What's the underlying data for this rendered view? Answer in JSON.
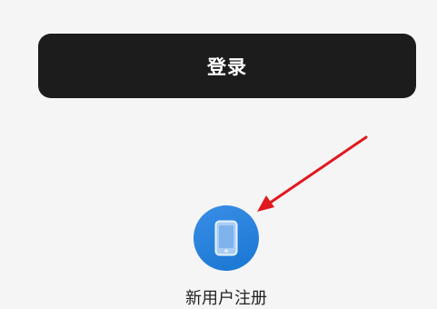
{
  "login": {
    "label": "登录"
  },
  "register": {
    "label": "新用户注册",
    "icon": "smartphone-icon"
  },
  "annotation": {
    "icon": "red-arrow-annotation"
  },
  "colors": {
    "background": "#f5f5f5",
    "login_button": "#1c1c1c",
    "register_icon": "#1976d2",
    "annotation_arrow": "#e0191f"
  }
}
